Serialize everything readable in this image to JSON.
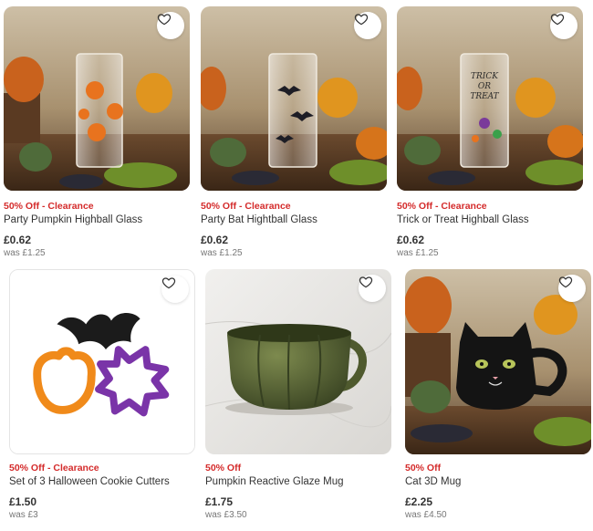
{
  "products": [
    {
      "promo": "50% Off - Clearance",
      "name": "Party Pumpkin Highball Glass",
      "price": "£0.62",
      "was": "was £1.25",
      "icon": "heart-outline-icon"
    },
    {
      "promo": "50% Off - Clearance",
      "name": "Party Bat Hightball Glass",
      "price": "£0.62",
      "was": "was £1.25",
      "icon": "heart-outline-icon"
    },
    {
      "promo": "50% Off - Clearance",
      "name": "Trick or Treat Highball Glass",
      "price": "£0.62",
      "was": "was £1.25",
      "glass_text": "TRICK OR TREAT",
      "icon": "heart-outline-icon"
    },
    {
      "promo": "50% Off - Clearance",
      "name": "Set of 3 Halloween Cookie Cutters",
      "price": "£1.50",
      "was": "was £3",
      "icon": "heart-outline-icon"
    },
    {
      "promo": "50% Off",
      "name": "Pumpkin Reactive Glaze Mug",
      "price": "£1.75",
      "was": "was £3.50",
      "icon": "heart-outline-icon"
    },
    {
      "promo": "50% Off",
      "name": "Cat 3D Mug",
      "price": "£2.25",
      "was": "was £4.50",
      "icon": "heart-outline-icon"
    }
  ],
  "colors": {
    "promo": "#d42b2b",
    "text": "#333333",
    "muted": "#777777"
  }
}
